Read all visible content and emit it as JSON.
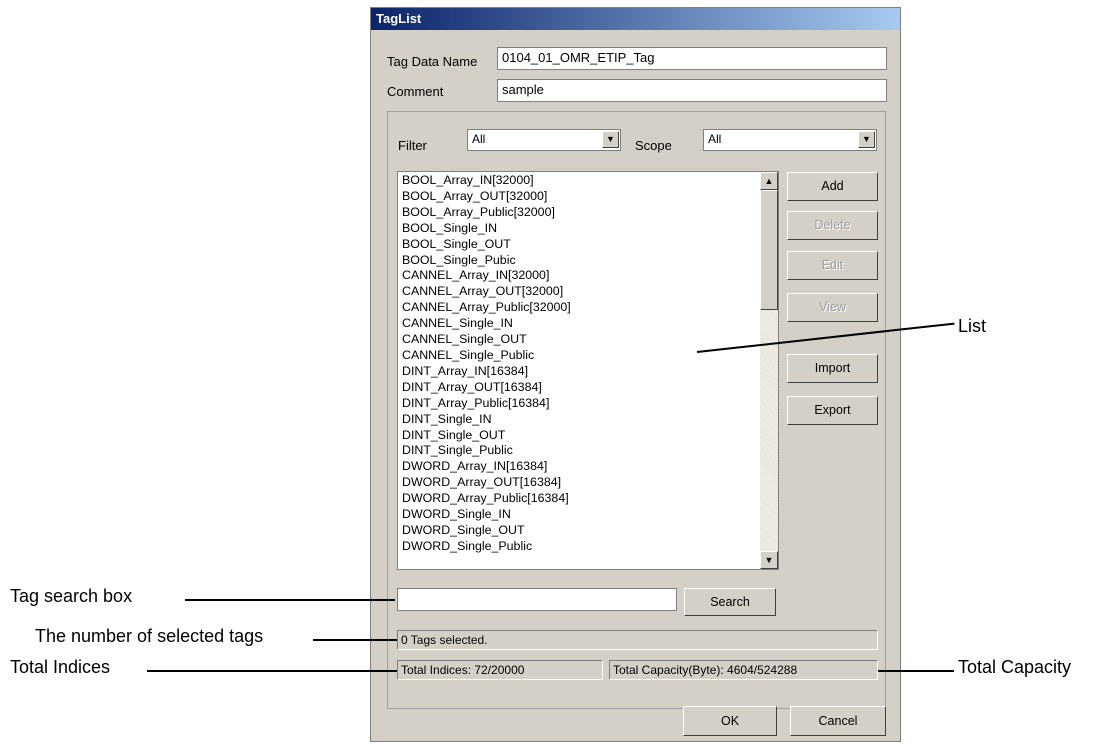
{
  "dialog": {
    "title": "TagList",
    "tag_data_name_label": "Tag Data Name",
    "tag_data_name_value": "0104_01_OMR_ETIP_Tag",
    "comment_label": "Comment",
    "comment_value": "sample",
    "filter_label": "Filter",
    "filter_value": "All",
    "scope_label": "Scope",
    "scope_value": "All",
    "tags": [
      "BOOL_Array_IN[32000]",
      "BOOL_Array_OUT[32000]",
      "BOOL_Array_Public[32000]",
      "BOOL_Single_IN",
      "BOOL_Single_OUT",
      "BOOL_Single_Pubic",
      "CANNEL_Array_IN[32000]",
      "CANNEL_Array_OUT[32000]",
      "CANNEL_Array_Public[32000]",
      "CANNEL_Single_IN",
      "CANNEL_Single_OUT",
      "CANNEL_Single_Public",
      "DINT_Array_IN[16384]",
      "DINT_Array_OUT[16384]",
      "DINT_Array_Public[16384]",
      "DINT_Single_IN",
      "DINT_Single_OUT",
      "DINT_Single_Public",
      "DWORD_Array_IN[16384]",
      "DWORD_Array_OUT[16384]",
      "DWORD_Array_Public[16384]",
      "DWORD_Single_IN",
      "DWORD_Single_OUT",
      "DWORD_Single_Public"
    ],
    "buttons": {
      "add": "Add",
      "delete": "Delete",
      "edit": "Edit",
      "view": "View",
      "import": "Import",
      "export": "Export",
      "search": "Search",
      "ok": "OK",
      "cancel": "Cancel"
    },
    "search_value": "",
    "selected_status": "0 Tags selected.",
    "total_indices": "Total Indices: 72/20000",
    "total_capacity": "Total Capacity(Byte): 4604/524288"
  },
  "annotations": {
    "list": "List",
    "tag_search_box": "Tag search box",
    "number_selected": "The number of selected tags",
    "total_indices": "Total Indices",
    "total_capacity": "Total Capacity"
  },
  "colors": {
    "title_start": "#0a246a",
    "title_end": "#a6caf0",
    "dialog_face": "#d4d0c8"
  }
}
